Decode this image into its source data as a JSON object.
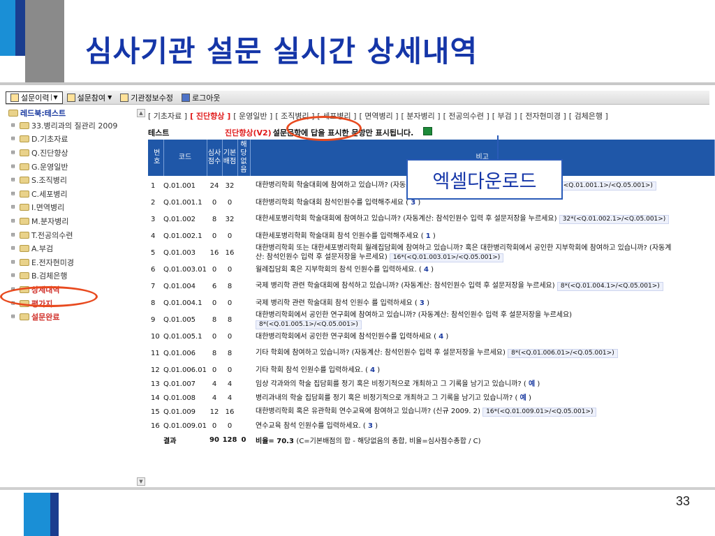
{
  "slide": {
    "title": "심사기관 설문 실시간 상세내역",
    "page_number": "33"
  },
  "menubar": {
    "items": [
      {
        "label": "설문이력",
        "active": true,
        "icon": "document-icon"
      },
      {
        "label": "설문참여",
        "icon": "pencil-icon"
      },
      {
        "label": "기관정보수정",
        "icon": "edit-icon"
      },
      {
        "label": "로그아웃",
        "icon": "save-icon"
      }
    ]
  },
  "tree": {
    "root": "레드북:테스트",
    "items": [
      {
        "label": "33.병리과의 질관리 2009",
        "highlight": false
      },
      {
        "label": "D.기초자료",
        "highlight": false
      },
      {
        "label": "Q.진단향상",
        "highlight": false
      },
      {
        "label": "G.운영일반",
        "highlight": false
      },
      {
        "label": "S.조직병리",
        "highlight": false
      },
      {
        "label": "C.세포병리",
        "highlight": false
      },
      {
        "label": "I.면역병리",
        "highlight": false
      },
      {
        "label": "M.분자병리",
        "highlight": false
      },
      {
        "label": "T.전공의수련",
        "highlight": false
      },
      {
        "label": "A.부검",
        "highlight": false
      },
      {
        "label": "E.전자현미경",
        "highlight": false
      },
      {
        "label": "B.검체은행",
        "highlight": false
      },
      {
        "label": "상세내역",
        "highlight": true
      },
      {
        "label": "평가지",
        "highlight": true
      },
      {
        "label": "설문완료",
        "highlight": true
      }
    ]
  },
  "tabs": [
    "[ 기초자료 ]",
    "[ 진단향상 ]",
    "[ 운영일반 ]",
    "[ 조직병리 ]",
    "[ 세포병리 ]",
    "[ 면역병리 ]",
    "[ 분자병리 ]",
    "[ 전공의수련 ]",
    "[ 부검 ]",
    "[ 전자현미경 ]",
    "[ 검체은행 ]"
  ],
  "active_tab": "진단향상",
  "subhead": {
    "name": "테스트",
    "category": "진단향상(V2)",
    "description": "설문문항에 답을 표시한 문항만 표시됩니다."
  },
  "callout": {
    "label": "엑셀다운로드"
  },
  "table": {
    "headers": [
      "번호",
      "코드",
      "심사점수",
      "기본배점",
      "해당없음",
      "비고"
    ],
    "rows": [
      {
        "no": "1",
        "code": "Q.01.001",
        "score": "24",
        "base": "32",
        "na": "",
        "text": "대한병리학회 학술대회에 참여하고 있습니까? (자동계산: 참석인원수 입력 후 설문저장을 누르세요)",
        "formula": "32*(<Q.01.001.1>/<Q.05.001>)",
        "two": true
      },
      {
        "no": "2",
        "code": "Q.01.001.1",
        "score": "0",
        "base": "0",
        "na": "",
        "text": "대한병리학회 학술대회 참석인원수를 입력해주세요 ( ",
        "link": "3",
        "two": false
      },
      {
        "no": "3",
        "code": "Q.01.002",
        "score": "8",
        "base": "32",
        "na": "",
        "text": "대한세포병리학회 학술대회에 참여하고 있습니까? (자동계산: 참석인원수 입력 후 설문저장을 누르세요)",
        "formula": "32*(<Q.01.002.1>/<Q.05.001>)",
        "two": true
      },
      {
        "no": "4",
        "code": "Q.01.002.1",
        "score": "0",
        "base": "0",
        "na": "",
        "text": "대한세포병리학회 학술대회 참석 인원수를 입력해주세요 ( ",
        "link": "1",
        "two": false
      },
      {
        "no": "5",
        "code": "Q.01.003",
        "score": "16",
        "base": "16",
        "na": "",
        "text": "대한병리학회 또는 대한세포병리학회 월례집담회에 참여하고 있습니까? 혹은 대한병리학회에서 공인한 지부학회에 참여하고 있습니까? (자동계산: 참석인원수 입력 후 설문저장을 누르세요)",
        "formula": "16*(<Q.01.003.01>/<Q.05.001>)",
        "two": true
      },
      {
        "no": "6",
        "code": "Q.01.003.01",
        "score": "0",
        "base": "0",
        "na": "",
        "text": "월례집담회 혹은 지부학회의 참석 인원수를 입력하세요. ( ",
        "link": "4",
        "two": false
      },
      {
        "no": "7",
        "code": "Q.01.004",
        "score": "6",
        "base": "8",
        "na": "",
        "text": "국제 병리학 관련 학술대회에 참석하고 있습니까? (자동계산: 참석인원수 입력 후 설문저장을 누르세요)",
        "formula": "8*(<Q.01.004.1>/<Q.05.001>)",
        "two": true
      },
      {
        "no": "8",
        "code": "Q.01.004.1",
        "score": "0",
        "base": "0",
        "na": "",
        "text": "국제 병리학 관련 학술대회 참석 인원수 를 입력하세요 ( ",
        "link": "3",
        "two": false
      },
      {
        "no": "9",
        "code": "Q.01.005",
        "score": "8",
        "base": "8",
        "na": "",
        "text": "대한병리학회에서 공인한 연구회에 참여하고 있습니까? (자동계산: 참석인원수 입력 후 설문저장을 누르세요)",
        "formula": "8*(<Q.01.005.1>/<Q.05.001>)",
        "two": true
      },
      {
        "no": "10",
        "code": "Q.01.005.1",
        "score": "0",
        "base": "0",
        "na": "",
        "text": "대한병리학회에서 공인한 연구회에 참석인원수를 입력하세요 ( ",
        "link": "4",
        "two": false
      },
      {
        "no": "11",
        "code": "Q.01.006",
        "score": "8",
        "base": "8",
        "na": "",
        "text": "기타 학회에 참여하고 있습니까? (자동계산: 참석인원수 입력 후 설문저장을 누르세요)",
        "formula": "8*(<Q.01.006.01>/<Q.05.001>)",
        "two": true
      },
      {
        "no": "12",
        "code": "Q.01.006.01",
        "score": "0",
        "base": "0",
        "na": "",
        "text": "기타 학회 참석 인원수를 입력하세요. ( ",
        "link": "4",
        "two": false
      },
      {
        "no": "13",
        "code": "Q.01.007",
        "score": "4",
        "base": "4",
        "na": "",
        "text": "임상 각과와의 학술 집담회를 정기 혹은 비정기적으로 개최하고 그 기록을 남기고 있습니까? ( ",
        "link": "예",
        "two": false
      },
      {
        "no": "14",
        "code": "Q.01.008",
        "score": "4",
        "base": "4",
        "na": "",
        "text": "병리과내의 학술 집담회를 정기 혹은 비정기적으로 개최하고 그 기록을 남기고 있습니까? ( ",
        "link": "예",
        "two": false
      },
      {
        "no": "15",
        "code": "Q.01.009",
        "score": "12",
        "base": "16",
        "na": "",
        "text": "대한병리학회 혹은 유관학회 연수교육에 참여하고 있습니까? (신규 2009. 2)",
        "formula": "16*(<Q.01.009.01>/<Q.05.001>)",
        "two": false
      },
      {
        "no": "16",
        "code": "Q.01.009.01",
        "score": "0",
        "base": "0",
        "na": "",
        "text": "연수교육 참석 인원수를 입력하세요. ( ",
        "link": "3",
        "two": false
      }
    ],
    "total": {
      "label": "결과",
      "score": "90",
      "base": "128",
      "na": "0",
      "ratio": "비율= 70.3",
      "note": "(C=기본배점의 합 - 해당없음의 총합, 비율=심사점수총합 / C)"
    }
  }
}
